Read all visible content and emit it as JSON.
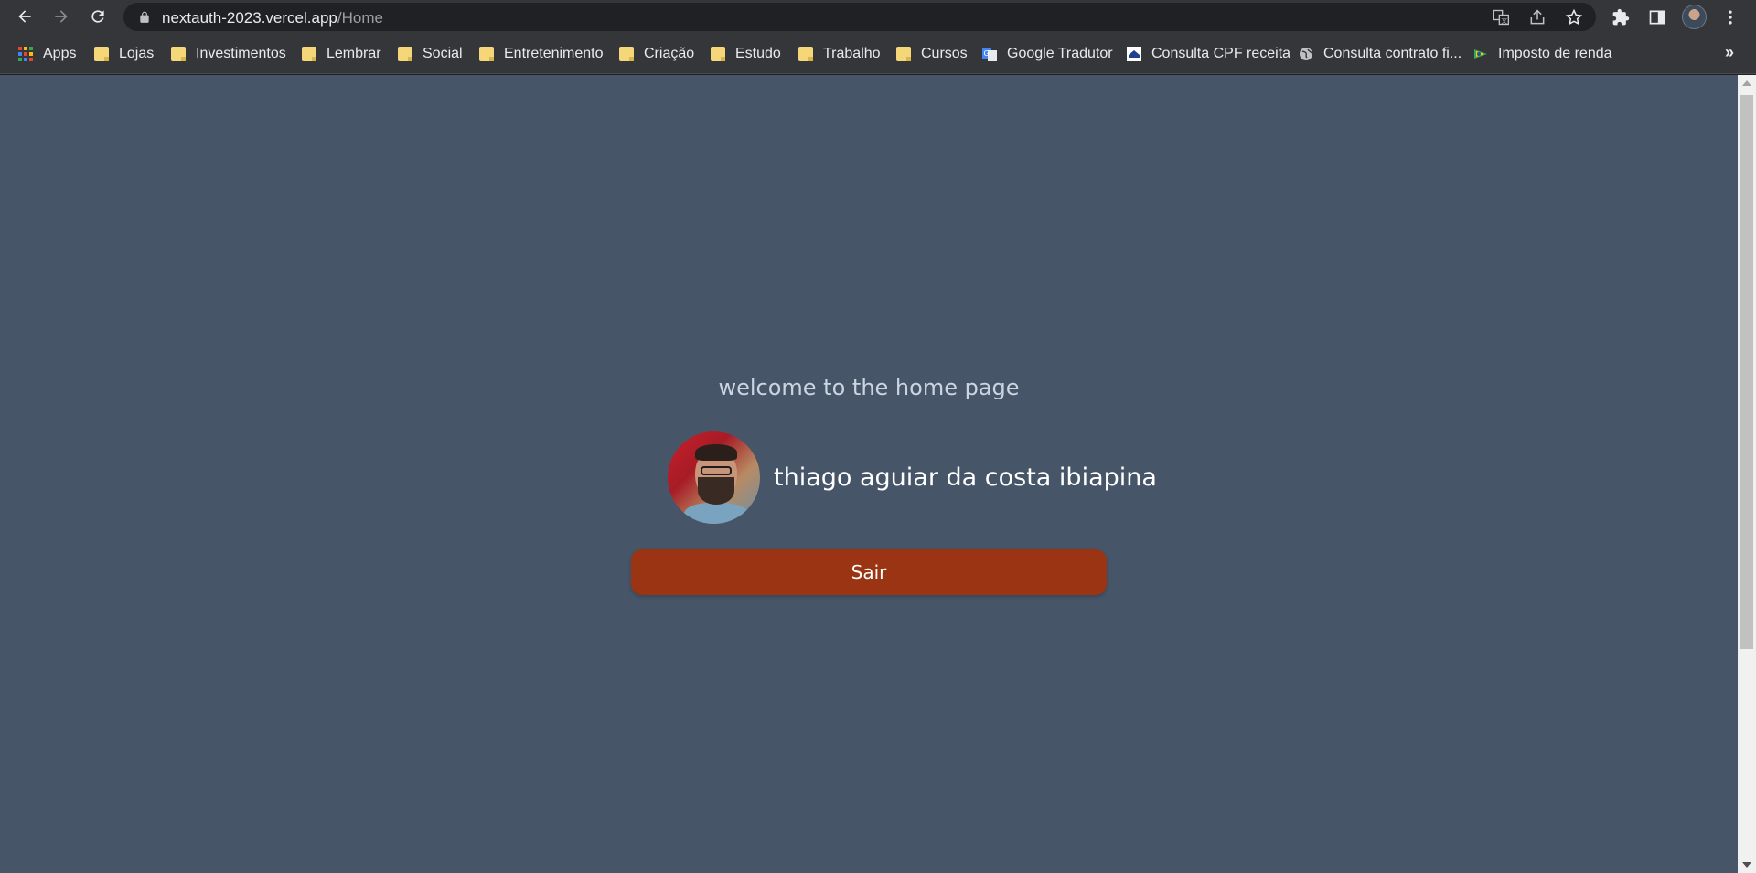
{
  "browser": {
    "url_host": "nextauth-2023.vercel.app",
    "url_path": "/Home"
  },
  "bookmarks": [
    {
      "label": "Apps",
      "icon": "apps-grid-icon"
    },
    {
      "label": "Lojas",
      "icon": "folder-icon"
    },
    {
      "label": "Investimentos",
      "icon": "folder-icon"
    },
    {
      "label": "Lembrar",
      "icon": "folder-icon"
    },
    {
      "label": "Social",
      "icon": "folder-icon"
    },
    {
      "label": "Entretenimento",
      "icon": "folder-icon"
    },
    {
      "label": "Criação",
      "icon": "folder-icon"
    },
    {
      "label": "Estudo",
      "icon": "folder-icon"
    },
    {
      "label": "Trabalho",
      "icon": "folder-icon"
    },
    {
      "label": "Cursos",
      "icon": "folder-icon"
    },
    {
      "label": "Google Tradutor",
      "icon": "google-translate-icon"
    },
    {
      "label": "Consulta CPF receita",
      "icon": "receita-icon"
    },
    {
      "label": "Consulta contrato fi...",
      "icon": "globe-icon"
    },
    {
      "label": "Imposto de renda",
      "icon": "brazil-flag-icon"
    }
  ],
  "bookmarks_more": "»",
  "page": {
    "welcome": "welcome to the home page",
    "user_name": "thiago aguiar da costa ibiapina",
    "logout_label": "Sair"
  },
  "colors": {
    "page_bg": "#475569",
    "button_bg": "#9a3412",
    "chrome_bg": "#35363a"
  }
}
